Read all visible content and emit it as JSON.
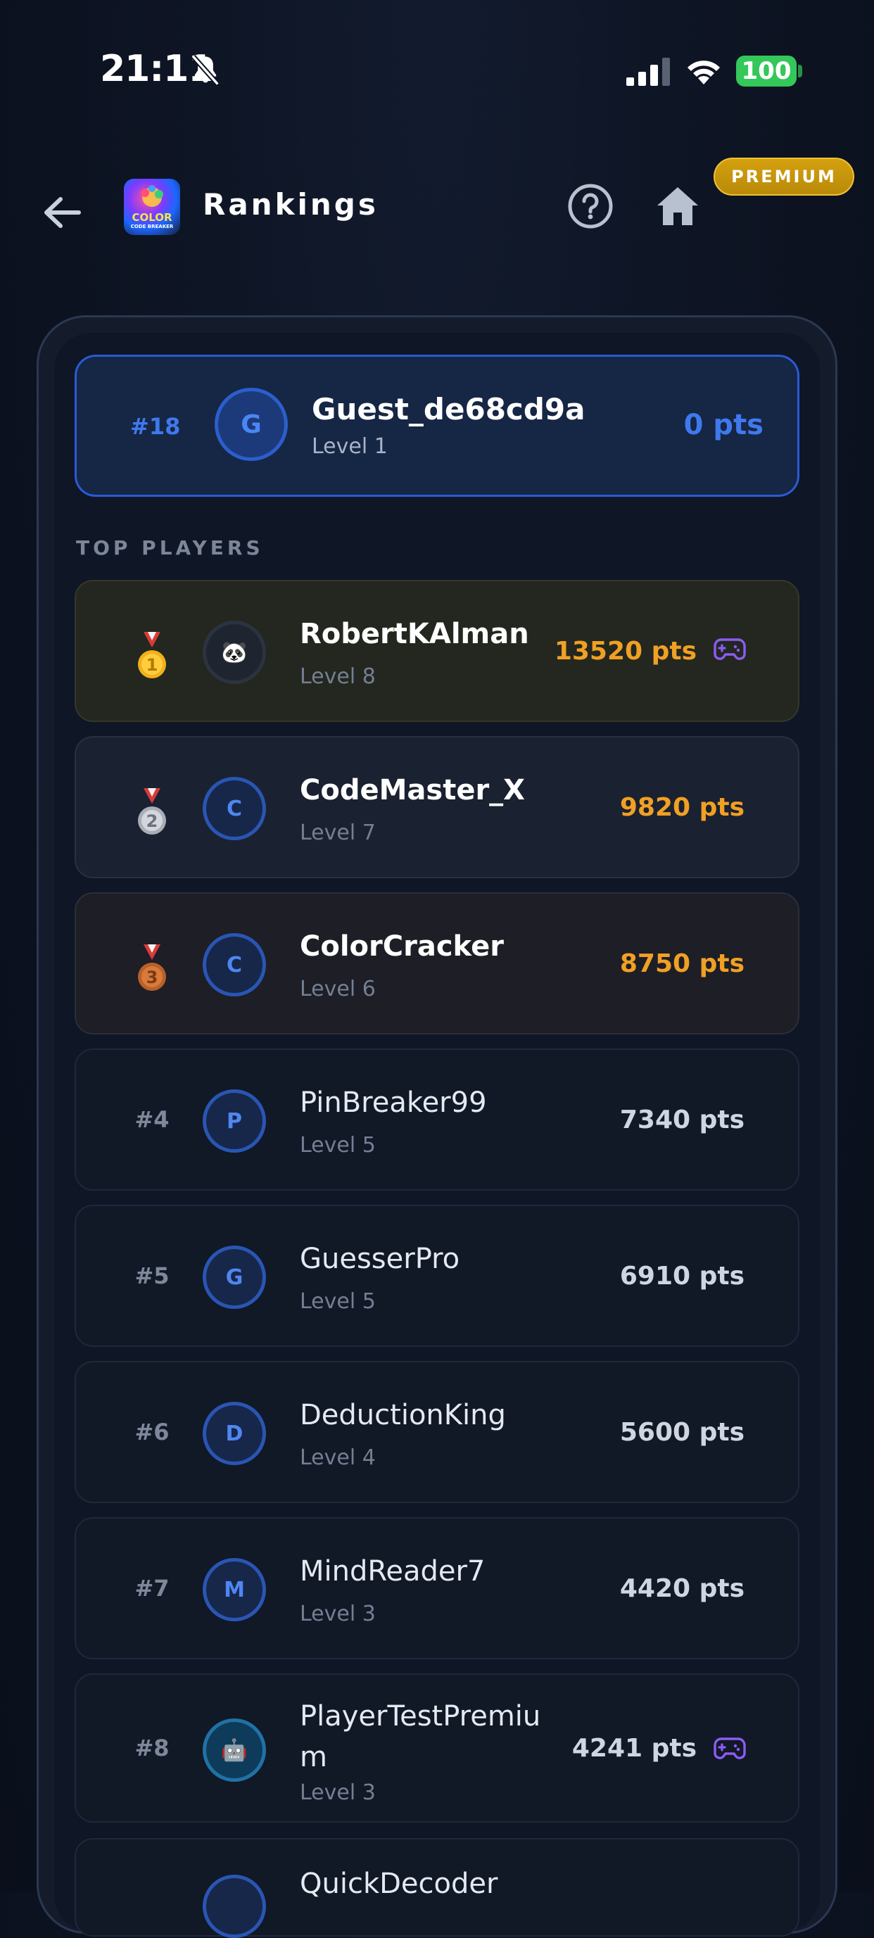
{
  "status_bar": {
    "time": "21:11",
    "battery": "100"
  },
  "header": {
    "title": "Rankings",
    "logo_text": "COLOR",
    "logo_sub": "CODE BREAKER",
    "premium_badge": "PREMIUM"
  },
  "my_rank": {
    "rank": "#18",
    "initial": "G",
    "name": "Guest_de68cd9a",
    "level": "Level 1",
    "points": "0 pts"
  },
  "section_label": "TOP PLAYERS",
  "players": [
    {
      "rank": "1",
      "avatar": "🐼",
      "name": "RobertKAlman",
      "level": "Level 8",
      "points": "13520 pts",
      "gamepad": true
    },
    {
      "rank": "2",
      "avatar": "C",
      "name": "CodeMaster_X",
      "level": "Level 7",
      "points": "9820 pts"
    },
    {
      "rank": "3",
      "avatar": "C",
      "name": "ColorCracker",
      "level": "Level 6",
      "points": "8750 pts"
    },
    {
      "rank": "#4",
      "avatar": "P",
      "name": "PinBreaker99",
      "level": "Level 5",
      "points": "7340 pts"
    },
    {
      "rank": "#5",
      "avatar": "G",
      "name": "GuesserPro",
      "level": "Level 5",
      "points": "6910 pts"
    },
    {
      "rank": "#6",
      "avatar": "D",
      "name": "DeductionKing",
      "level": "Level 4",
      "points": "5600 pts"
    },
    {
      "rank": "#7",
      "avatar": "M",
      "name": "MindReader7",
      "level": "Level 3",
      "points": "4420 pts"
    },
    {
      "rank": "#8",
      "avatar": "🤖",
      "name": "PlayerTestPremiu",
      "name_wrap": "m",
      "level": "Level 3",
      "points": "4241 pts",
      "gamepad": true
    },
    {
      "name": "QuickDecoder"
    }
  ],
  "colors": {
    "accent_blue": "#3f79ee",
    "gold_points": "#f0a024",
    "premium": "#d4a010",
    "gamepad": "#8b5cf6"
  }
}
